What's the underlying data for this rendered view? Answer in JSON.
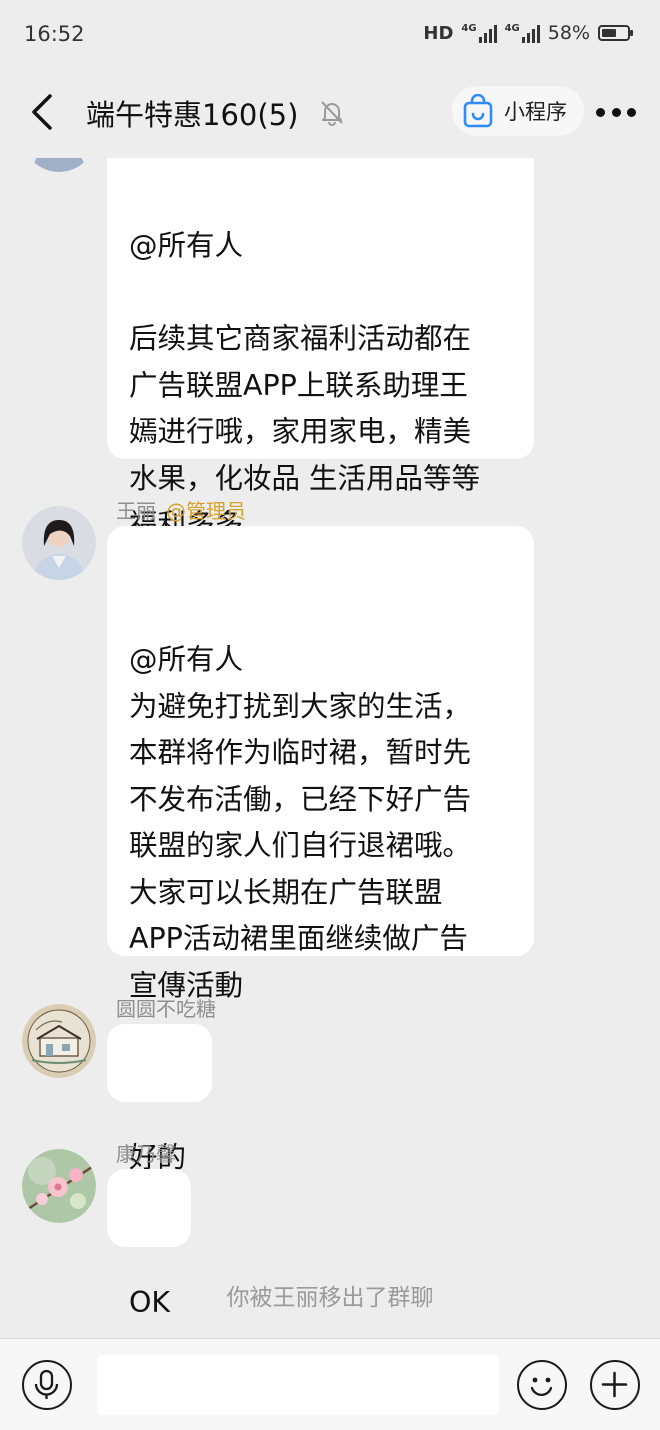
{
  "status_bar": {
    "time": "16:52",
    "hd": "HD",
    "network_1": "4G",
    "network_2": "4G",
    "battery_percent": "58%",
    "battery_level": 0.58
  },
  "header": {
    "title": "端午特惠160(5)",
    "mini_program_label": "小程序"
  },
  "messages": [
    {
      "id": "m1",
      "sender": "",
      "text": "@所有人\n\n后续其它商家福利活动都在\n广告联盟APP上联系助理王\n嫣进行哦，家用家电，精美\n水果，化妆品 生活用品等等\n福利多多"
    },
    {
      "id": "m2",
      "sender": "王丽",
      "tag": "@管理员",
      "text": "@所有人\n为避免打扰到大家的生活，\n本群将作为临时裙，暂时先\n不发布活働，已经下好广告\n联盟的家人们自行退裙哦。\n大家可以长期在广告联盟\nAPP活动裙里面继续做广告\n宣傳活動"
    },
    {
      "id": "m3",
      "sender": "圆圆不吃糖",
      "text": "好的"
    },
    {
      "id": "m4",
      "sender": "康乃馨",
      "text": "OK"
    }
  ],
  "system_message": "你被王丽移出了群聊",
  "input": {
    "value": "",
    "placeholder": ""
  },
  "icons": {
    "back": "back-arrow-icon",
    "mute": "bell-off-icon",
    "mini_program": "shopping-bag-icon",
    "more": "more-dots-icon",
    "voice": "microphone-icon",
    "emoji": "smile-icon",
    "plus": "plus-icon"
  },
  "colors": {
    "background": "#ededed",
    "bubble": "#ffffff",
    "admin_tag": "#d7a22a",
    "mini_program_accent": "#2f8cff"
  }
}
